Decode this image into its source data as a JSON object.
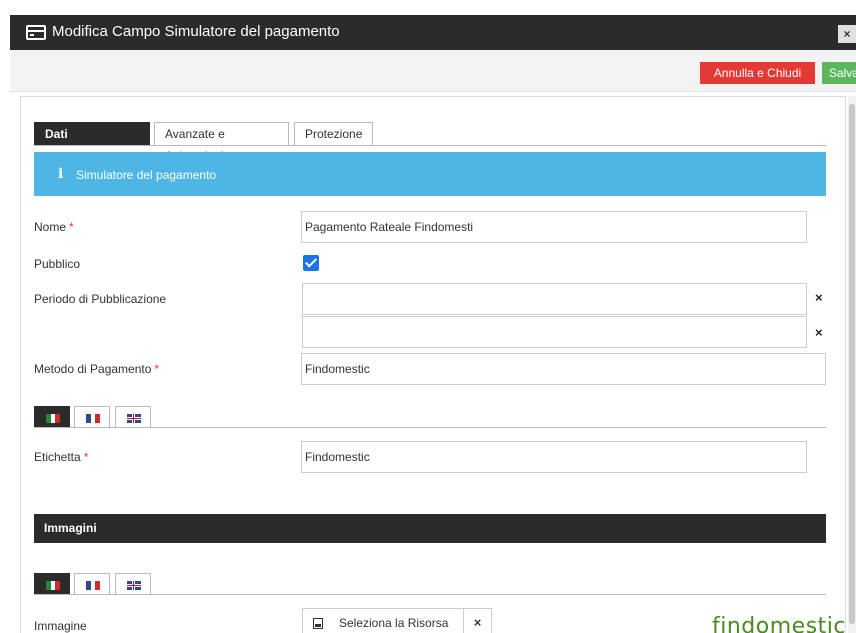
{
  "window": {
    "title": "Modifica Campo Simulatore del pagamento",
    "icon": "window-icon",
    "close": "×"
  },
  "toolbar": {
    "cancel_label": "Annulla e Chiudi",
    "save_label": "Salva",
    "colors": {
      "cancel": "#e53935",
      "save": "#5cb85c"
    }
  },
  "tabs": [
    {
      "label": "Dati Componente",
      "active": true
    },
    {
      "label": "Avanzate e Animazioni",
      "active": false
    },
    {
      "label": "Protezione",
      "active": false
    }
  ],
  "info": {
    "icon": "info-icon",
    "glyph": "i",
    "text": "Simulatore del pagamento",
    "color": "#4db6e4"
  },
  "form": {
    "nome": {
      "label": "Nome",
      "required_mark": "*",
      "value": "Pagamento Rateale Findomesti"
    },
    "pubblico": {
      "label": "Pubblico",
      "checked": true
    },
    "periodo": {
      "label": "Periodo di Pubblicazione",
      "start_value": "",
      "end_value": "",
      "clear": "×"
    },
    "metodo": {
      "label": "Metodo di Pagamento",
      "required_mark": "*",
      "value": "Findomestic"
    },
    "etichetta": {
      "label": "Etichetta",
      "required_mark": "*",
      "value": "Findomestic"
    }
  },
  "languages": [
    {
      "code": "it",
      "icon": "italy-flag-icon",
      "active": true
    },
    {
      "code": "fr",
      "icon": "france-flag-icon",
      "active": false
    },
    {
      "code": "en",
      "icon": "uk-flag-icon",
      "active": false
    }
  ],
  "images_section": {
    "title": "Immagini",
    "immagine": {
      "label": "Immagine",
      "button_label": "Seleziona la Risorsa",
      "clear": "×"
    },
    "preview_text": "findomestic"
  }
}
